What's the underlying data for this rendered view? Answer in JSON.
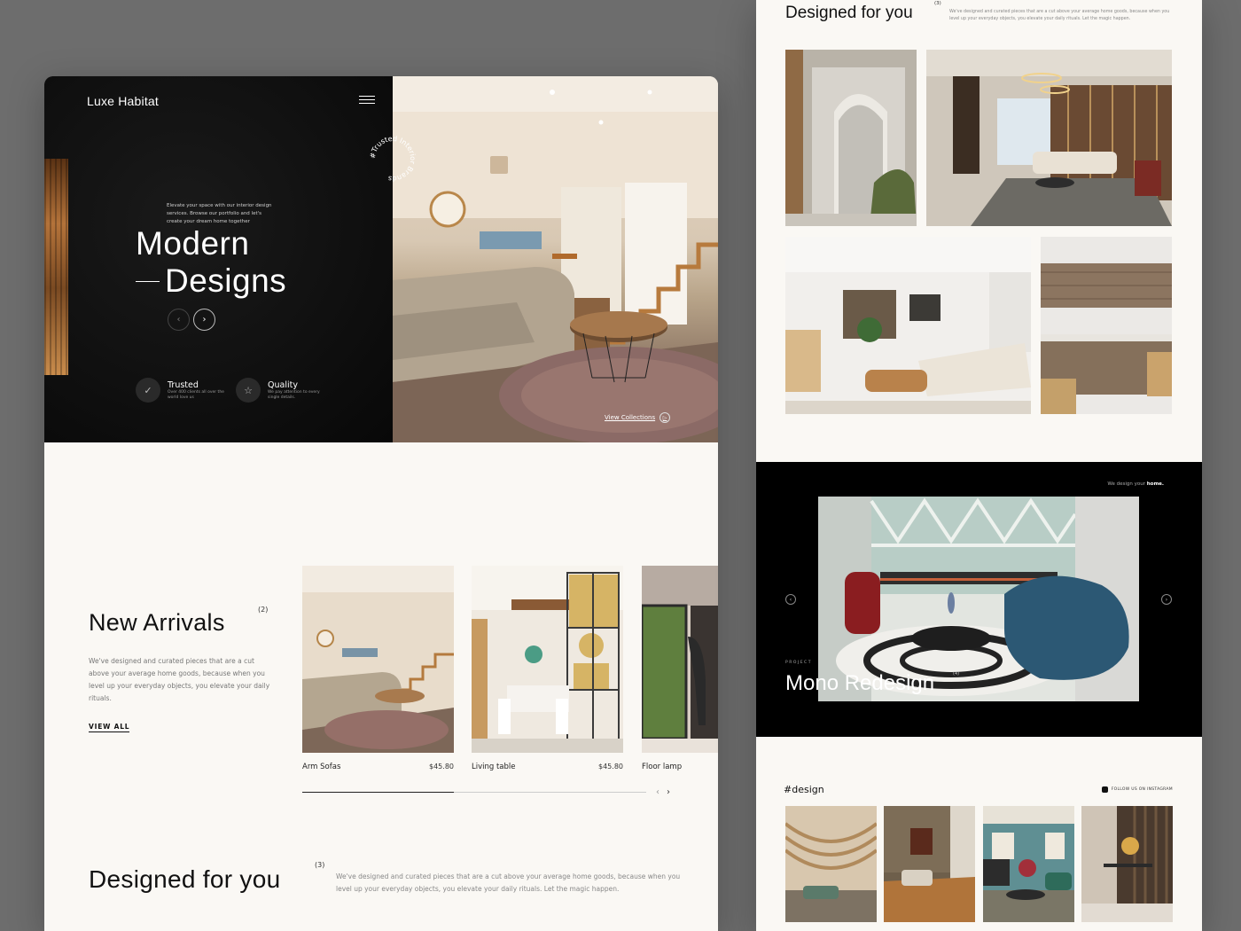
{
  "landing": {
    "brand": "Luxe Habitat",
    "hero": {
      "intro": "Elevate your space with our interior design services. Browse our portfolio and let's create your dream home together",
      "title_line1": "Modern",
      "title_line2": "Designs",
      "stamp_text": "#Trusted Interior Brands",
      "prev_icon": "chevron-left-icon",
      "next_icon": "chevron-right-icon",
      "features": [
        {
          "icon": "check-icon",
          "title": "Trusted",
          "desc": "Over 400 clients all over the world love us"
        },
        {
          "icon": "star-icon",
          "title": "Quality",
          "desc": "We pay attention to every single details."
        }
      ],
      "view_collections": "View Collections"
    },
    "new_arrivals": {
      "title": "New Arrivals",
      "count": "(2)",
      "desc": "We've designed and curated pieces that are a cut above your average home goods, because when you level up your everyday objects, you elevate your daily rituals.",
      "view_all": "VIEW ALL",
      "products": [
        {
          "name": "Arm Sofas",
          "price": "$45.80"
        },
        {
          "name": "Living table",
          "price": "$45.80"
        },
        {
          "name": "Floor lamp",
          "price": ""
        }
      ],
      "slider_progress": 0.44
    },
    "designed_for_you": {
      "title": "Designed for you",
      "count": "(3)",
      "desc": "We've designed and curated pieces that are a cut above your average home goods, because when you level up your everyday objects, you elevate your daily rituals. Let the magic happen."
    }
  },
  "detail": {
    "designed_for_you": {
      "title": "Designed for you",
      "count": "(3)",
      "desc": "We've designed and curated pieces that are a cut above your average home goods, because when you level up your everyday objects, you elevate your daily rituals. Let the magic happen."
    },
    "band": {
      "tag_prefix": "We design your",
      "tag_strong": "home.",
      "project_kicker": "PROJECT",
      "project_title": "Mono Redesign",
      "project_count": "(4)"
    },
    "instagram": {
      "title": "#design",
      "follow": "FOLLOW US ON INSTAGRAM"
    }
  }
}
